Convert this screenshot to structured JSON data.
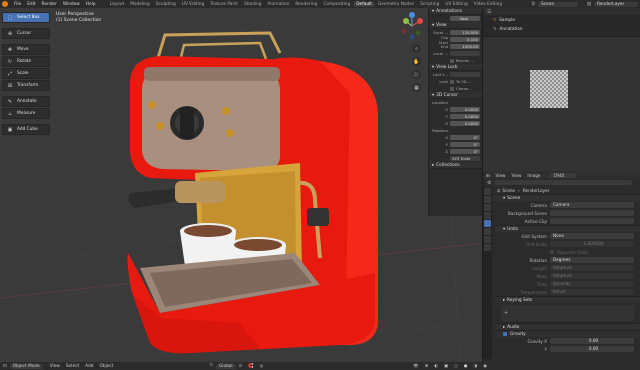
{
  "menu": {
    "items": [
      "File",
      "Edit",
      "Render",
      "Window",
      "Help"
    ],
    "workspaces": [
      "Layout",
      "Modeling",
      "Sculpting",
      "UV Editing",
      "Texture Paint",
      "Shading",
      "Animation",
      "Rendering",
      "Compositing",
      "Default",
      "Geometry Nodes",
      "Scripting",
      "UV Editing",
      "Video Editing"
    ],
    "active_workspace": "Default",
    "scene": "Scene",
    "view_layer": "RenderLayer"
  },
  "viewport": {
    "perspective": "User Perspective",
    "collection": "(1) Scene Collection"
  },
  "tools": [
    {
      "label": "Select Box",
      "icon": "select-box-icon",
      "glyph": "⬚",
      "active": true
    },
    {
      "label": "Cursor",
      "icon": "cursor-icon",
      "glyph": "⊕",
      "active": false
    },
    {
      "label": "Move",
      "icon": "move-icon",
      "glyph": "✥",
      "active": false
    },
    {
      "label": "Rotate",
      "icon": "rotate-icon",
      "glyph": "↻",
      "active": false
    },
    {
      "label": "Scale",
      "icon": "scale-icon",
      "glyph": "⤢",
      "active": false
    },
    {
      "label": "Transform",
      "icon": "transform-icon",
      "glyph": "⊞",
      "active": false
    },
    {
      "label": "Annotate",
      "icon": "annotate-icon",
      "glyph": "✎",
      "active": false
    },
    {
      "label": "Measure",
      "icon": "measure-icon",
      "glyph": "📏",
      "active": false
    },
    {
      "label": "Add Cube",
      "icon": "add-cube-icon",
      "glyph": "▣",
      "active": false
    }
  ],
  "npanel": {
    "annotations_label": "Annotations",
    "new_label": "New",
    "view_header": "View",
    "focal_label": "Focal ...",
    "focal_value": "120.000",
    "clip_start_label": "Clip Start",
    "clip_start_value": "0.100",
    "clip_end_label": "End",
    "clip_end_value": "1000.00",
    "local_label": "Local ...",
    "render_label": "Render ...",
    "view_lock_header": "View Lock",
    "lock_to_obj_label": "Lock t...",
    "lock_label": "Lock",
    "to_3d_label": "To 3D ...",
    "camera_label": "Camer...",
    "cursor_header": "3D Cursor",
    "location_label": "Location",
    "x_label": "X",
    "x_value": "0.0000",
    "y_label": "Y",
    "y_value": "0.0000",
    "z_label": "Z",
    "z_value": "0.0000",
    "rotation_label": "Rotation",
    "rx_value": "0°",
    "ry_value": "0°",
    "rz_value": "0°",
    "xyz_euler": "XYZ Euler",
    "collections_header": "Collections",
    "tabs": [
      "Item",
      "Tool",
      "View"
    ]
  },
  "outliner": {
    "items": [
      {
        "label": "Sample",
        "icon": "object-icon"
      },
      {
        "label": "Annotation",
        "icon": "annotation-icon"
      }
    ]
  },
  "image_editor": {
    "menu": [
      "View",
      "View",
      "Image"
    ],
    "image_name": "1940"
  },
  "properties": {
    "breadcrumb_scene": "Scene",
    "breadcrumb_layer": "RenderLayer",
    "scene_header": "Scene",
    "camera_label": "Camera",
    "camera_value": "Camera",
    "background_label": "Background Scene",
    "active_clip_label": "Active Clip",
    "units_header": "Units",
    "unit_system_label": "Unit System",
    "unit_system_value": "None",
    "unit_scale_label": "Unit Scale",
    "unit_scale_value": "1.000000",
    "separate_units_label": "Separate Units",
    "rotation_label": "Rotation",
    "rotation_value": "Degrees",
    "length_label": "Length",
    "length_value": "Adaptive",
    "mass_label": "Mass",
    "mass_value": "Adaptive",
    "time_label": "Time",
    "time_value": "Seconds",
    "temperature_label": "Temperature",
    "temperature_value": "Kelvin",
    "keying_header": "Keying Sets",
    "audio_header": "Audio",
    "gravity_header": "Gravity",
    "gravity_x_label": "Gravity X",
    "gravity_x_value": "0.00",
    "gravity_y_label": "Y",
    "gravity_y_value": "0.00"
  },
  "bottom": {
    "mode": "Object Mode",
    "menus": [
      "View",
      "Select",
      "Add",
      "Object"
    ],
    "orientation": "Global"
  },
  "colors": {
    "accent": "#4772b3",
    "machine_red": "#e8190f",
    "machine_beige": "#a88f7f",
    "blender_orange": "#e87d0d"
  }
}
